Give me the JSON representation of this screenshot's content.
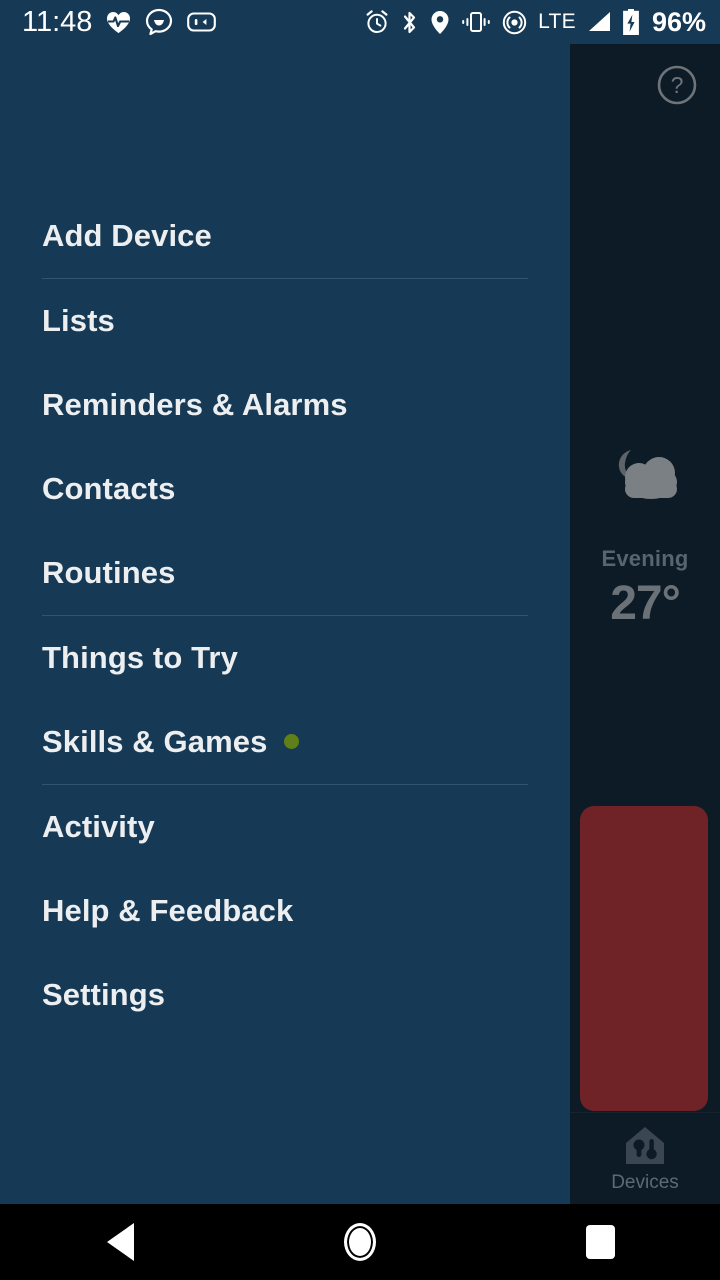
{
  "status_bar": {
    "clock": "11:48",
    "battery_percent": "96%",
    "network_label": "LTE",
    "left_icons": [
      "heart-rate-icon",
      "chat-smiley-icon",
      "messaging-icon"
    ],
    "right_icons": [
      "alarm-icon",
      "bluetooth-icon",
      "location-icon",
      "vibrate-icon",
      "hotspot-icon",
      "signal-icon",
      "battery-charging-icon"
    ],
    "background_color": "#163a56",
    "text_color": "#ffffff"
  },
  "drawer": {
    "background_color": "#163a56",
    "text_color": "#eceef0",
    "divider_color": "#2f5570",
    "badge_color": "#5f8019",
    "items": [
      {
        "label": "Add Device",
        "badge": false,
        "divider_after": true
      },
      {
        "label": "Lists",
        "badge": false,
        "divider_after": false
      },
      {
        "label": "Reminders & Alarms",
        "badge": false,
        "divider_after": false
      },
      {
        "label": "Contacts",
        "badge": false,
        "divider_after": false
      },
      {
        "label": "Routines",
        "badge": false,
        "divider_after": true
      },
      {
        "label": "Things to Try",
        "badge": false,
        "divider_after": false
      },
      {
        "label": "Skills & Games",
        "badge": true,
        "divider_after": true
      },
      {
        "label": "Activity",
        "badge": false,
        "divider_after": false
      },
      {
        "label": "Help & Feedback",
        "badge": false,
        "divider_after": false
      },
      {
        "label": "Settings",
        "badge": false,
        "divider_after": false
      }
    ]
  },
  "background_app": {
    "background_color": "#0d1b26",
    "help_icon": "help-circle-icon",
    "weather": {
      "icon": "moon-behind-cloud-icon",
      "period": "Evening",
      "temperature": "27°"
    },
    "card": {
      "color": "#702326"
    },
    "bottom_nav": {
      "icon": "smart-home-devices-icon",
      "label": "Devices"
    }
  },
  "android_nav": {
    "background_color": "#000000",
    "buttons": [
      {
        "name": "back",
        "icon": "back-triangle-icon"
      },
      {
        "name": "home",
        "icon": "home-circle-icon"
      },
      {
        "name": "recents",
        "icon": "recents-square-icon"
      }
    ]
  }
}
